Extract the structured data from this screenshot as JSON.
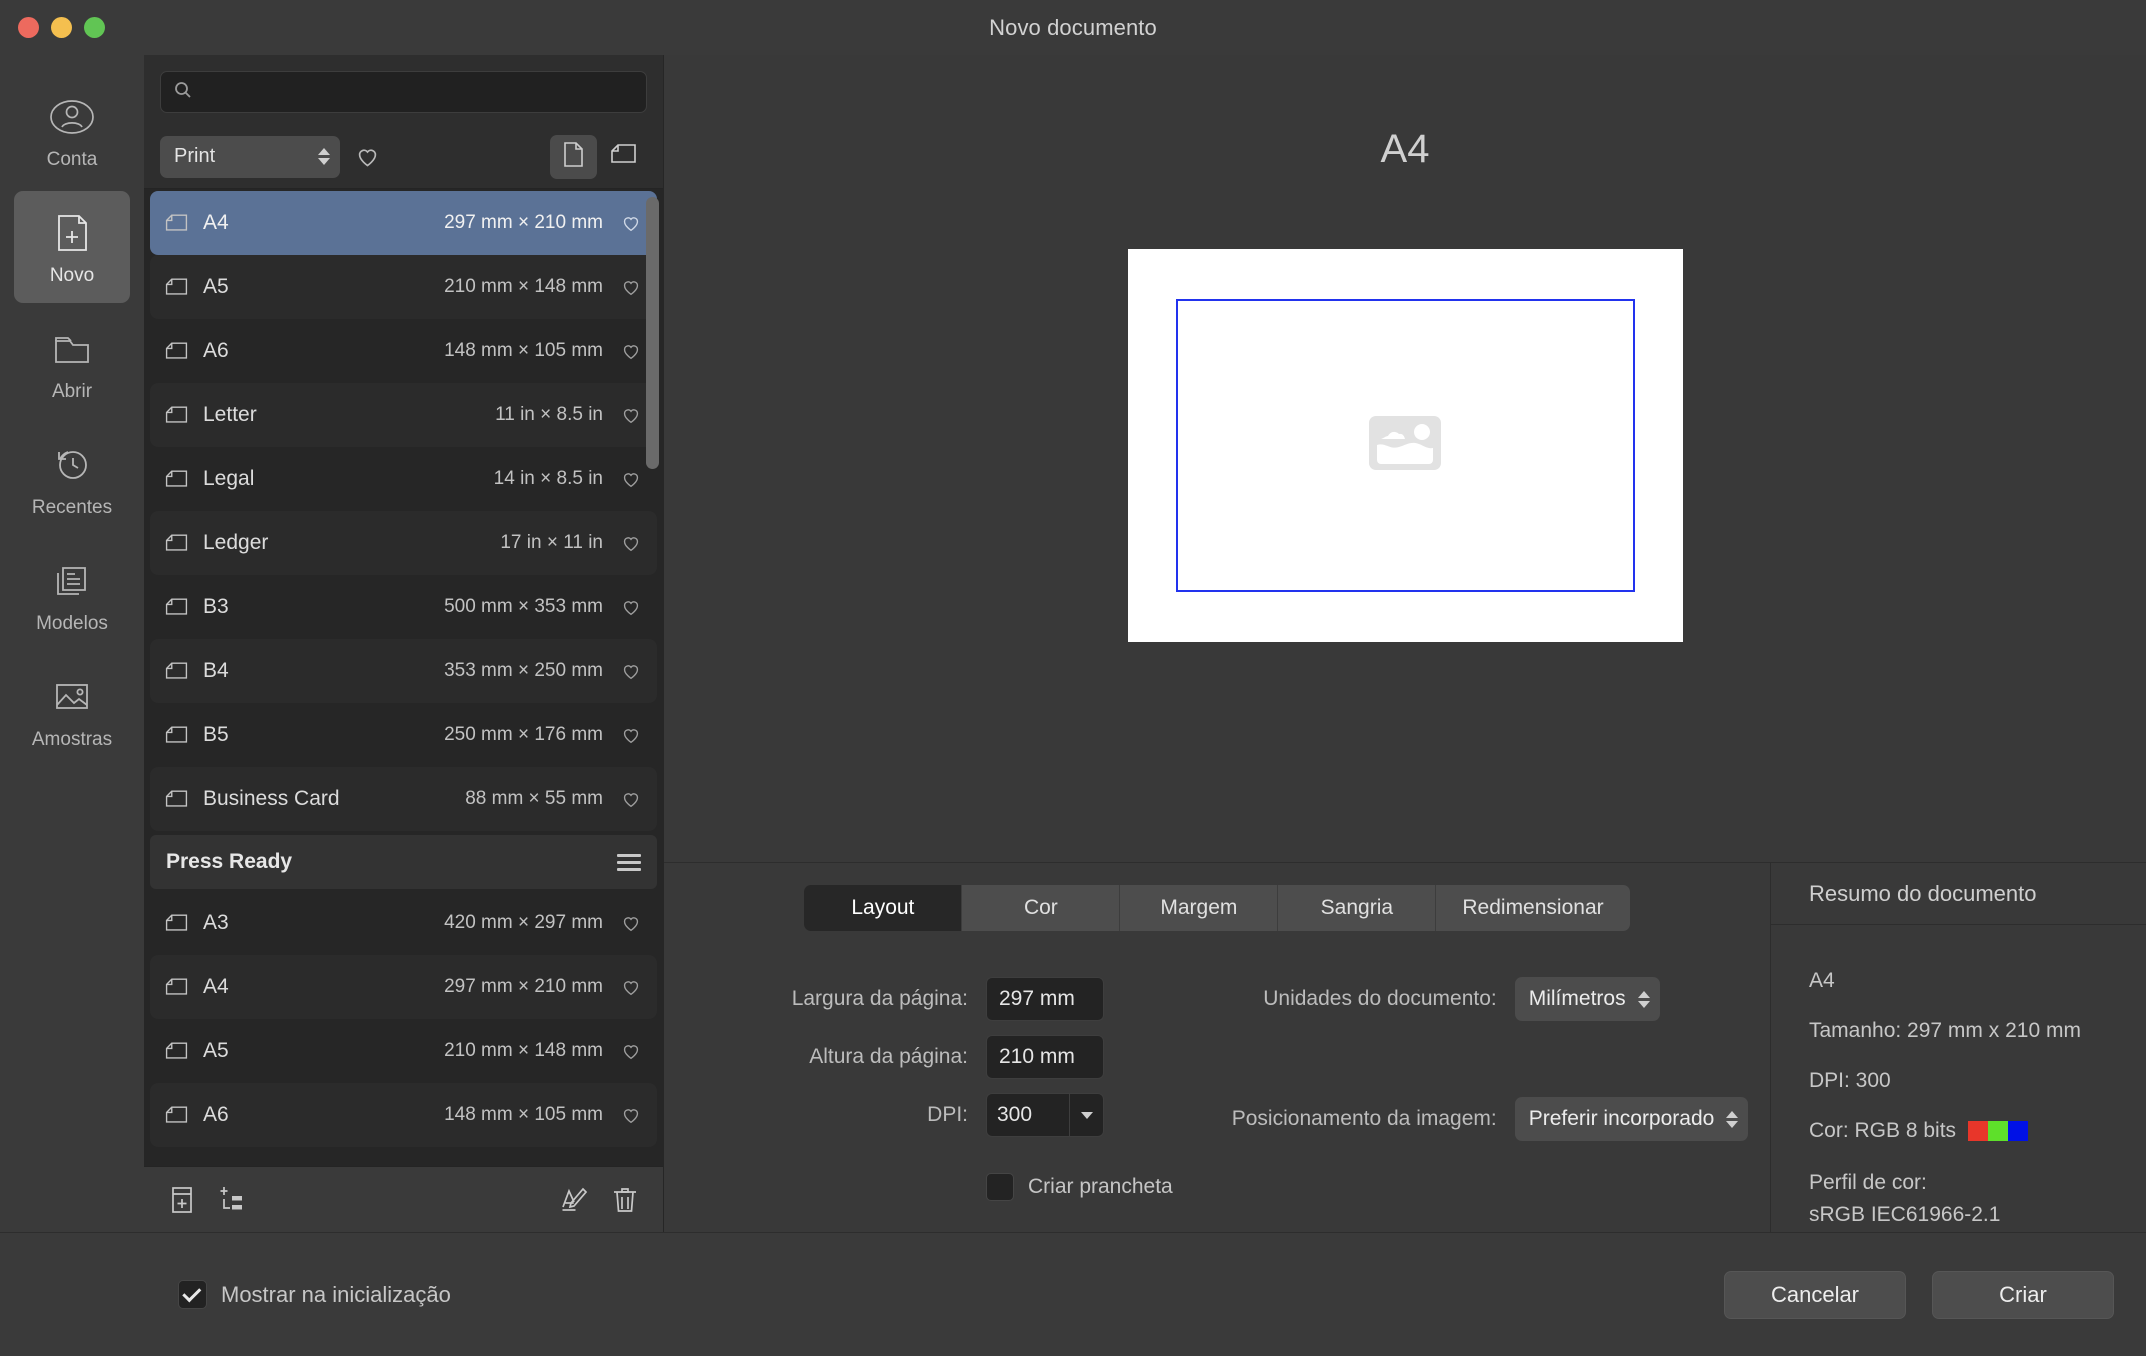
{
  "window": {
    "title": "Novo documento",
    "traffic_lights": [
      "close",
      "minimize",
      "zoom"
    ]
  },
  "rail": {
    "items": [
      {
        "label": "Conta",
        "icon": "account-icon",
        "active": false
      },
      {
        "label": "Novo",
        "icon": "new-document-icon",
        "active": true
      },
      {
        "label": "Abrir",
        "icon": "folder-open-icon",
        "active": false
      },
      {
        "label": "Recentes",
        "icon": "clock-history-icon",
        "active": false
      },
      {
        "label": "Modelos",
        "icon": "templates-icon",
        "active": false
      },
      {
        "label": "Amostras",
        "icon": "samples-image-icon",
        "active": false
      }
    ]
  },
  "presets": {
    "search_placeholder": "",
    "search_value": "",
    "category": "Print",
    "view_modes": [
      "portrait-view",
      "landscape-view"
    ],
    "active_view_mode": "portrait-view",
    "sections": [
      {
        "name": "",
        "rows": [
          {
            "name": "A4",
            "dimensions": "297 mm × 210 mm",
            "selected": true
          },
          {
            "name": "A5",
            "dimensions": "210 mm × 148 mm",
            "selected": false
          },
          {
            "name": "A6",
            "dimensions": "148 mm × 105 mm",
            "selected": false
          },
          {
            "name": "Letter",
            "dimensions": "11 in × 8.5 in",
            "selected": false
          },
          {
            "name": "Legal",
            "dimensions": "14 in × 8.5 in",
            "selected": false
          },
          {
            "name": "Ledger",
            "dimensions": "17 in × 11 in",
            "selected": false
          },
          {
            "name": "B3",
            "dimensions": "500 mm × 353 mm",
            "selected": false
          },
          {
            "name": "B4",
            "dimensions": "353 mm × 250 mm",
            "selected": false
          },
          {
            "name": "B5",
            "dimensions": "250 mm × 176 mm",
            "selected": false
          },
          {
            "name": "Business Card",
            "dimensions": "88 mm × 55 mm",
            "selected": false
          }
        ]
      },
      {
        "name": "Press Ready",
        "rows": [
          {
            "name": "A3",
            "dimensions": "420 mm × 297 mm",
            "selected": false
          },
          {
            "name": "A4",
            "dimensions": "297 mm × 210 mm",
            "selected": false
          },
          {
            "name": "A5",
            "dimensions": "210 mm × 148 mm",
            "selected": false
          },
          {
            "name": "A6",
            "dimensions": "148 mm × 105 mm",
            "selected": false
          }
        ]
      }
    ],
    "toolbar_icons": [
      "add-preset-icon",
      "add-category-icon",
      "rename-icon",
      "delete-icon"
    ]
  },
  "preview": {
    "title": "A4",
    "placeholder_icon": "image-placeholder-icon",
    "margin_color": "#2233ee"
  },
  "options": {
    "tabs": [
      {
        "label": "Layout",
        "active": true
      },
      {
        "label": "Cor",
        "active": false
      },
      {
        "label": "Margem",
        "active": false
      },
      {
        "label": "Sangria",
        "active": false
      },
      {
        "label": "Redimensionar",
        "active": false
      }
    ],
    "page_width": {
      "label": "Largura da página:",
      "value": "297 mm"
    },
    "page_height": {
      "label": "Altura da página:",
      "value": "210 mm"
    },
    "dpi": {
      "label": "DPI:",
      "value": "300"
    },
    "create_artboard": {
      "label": "Criar prancheta",
      "checked": false
    },
    "document_units": {
      "label": "Unidades do documento:",
      "value": "Milímetros"
    },
    "image_placement": {
      "label": "Posicionamento da imagem:",
      "value": "Preferir incorporado"
    }
  },
  "summary": {
    "heading": "Resumo do documento",
    "preset": "A4",
    "size": "Tamanho: 297 mm x 210 mm",
    "dpi": "DPI:  300",
    "color": "Cor: RGB 8 bits",
    "swatches": [
      "#e8362a",
      "#5ee02a",
      "#0011e6"
    ],
    "profile_label": "Perfil de cor:",
    "profile_value": "sRGB IEC61966-2.1"
  },
  "footer": {
    "show_on_startup": {
      "label": "Mostrar na inicialização",
      "checked": true
    },
    "cancel_label": "Cancelar",
    "create_label": "Criar"
  }
}
